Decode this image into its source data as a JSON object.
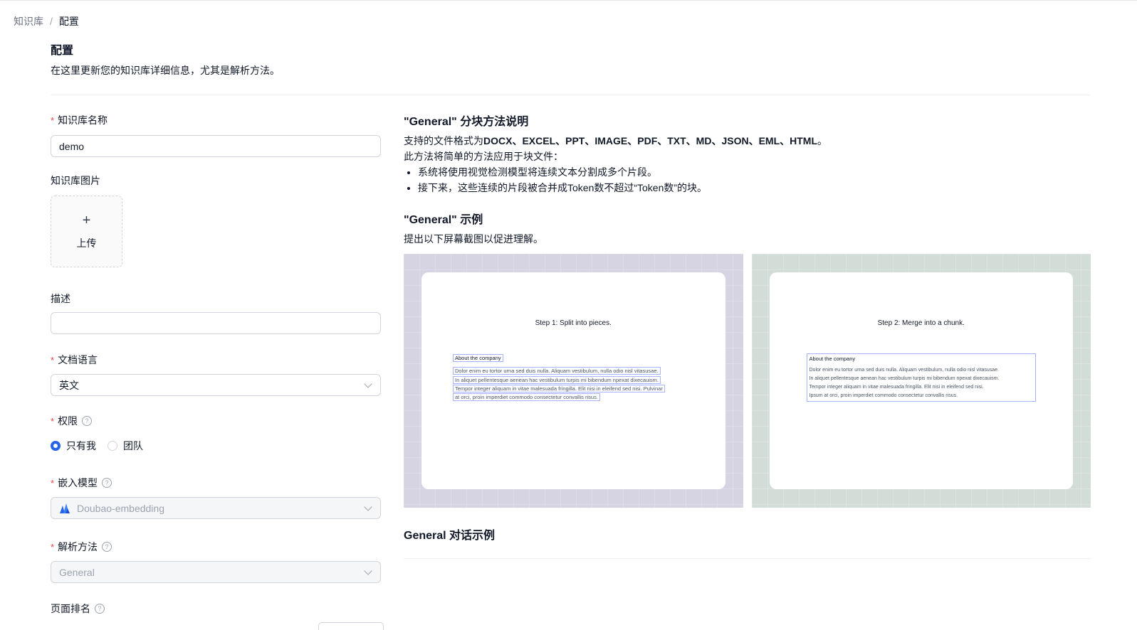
{
  "breadcrumb": {
    "parent": "知识库",
    "separator": "/",
    "current": "配置"
  },
  "header": {
    "title": "配置",
    "description": "在这里更新您的知识库详细信息，尤其是解析方法。"
  },
  "form": {
    "required_mark": "*",
    "name": {
      "label": "知识库名称",
      "value": "demo"
    },
    "image": {
      "label": "知识库图片",
      "upload_plus": "+",
      "upload_label": "上传"
    },
    "description": {
      "label": "描述",
      "value": ""
    },
    "language": {
      "label": "文档语言",
      "value": "英文"
    },
    "permission": {
      "label": "权限",
      "help": "?",
      "options": [
        {
          "label": "只有我",
          "selected": true
        },
        {
          "label": "团队",
          "selected": false
        }
      ]
    },
    "embedding_model": {
      "label": "嵌入模型",
      "help": "?",
      "value": "Doubao-embedding",
      "icon": "doubao-logo-icon"
    },
    "parse_method": {
      "label": "解析方法",
      "help": "?",
      "value": "General"
    },
    "page_rank": {
      "label": "页面排名",
      "help": "?"
    }
  },
  "explain": {
    "title": "\"General\" 分块方法说明",
    "formats_prefix": "支持的文件格式为",
    "formats": "DOCX、EXCEL、PPT、IMAGE、PDF、TXT、MD、JSON、EML、HTML",
    "formats_suffix": "。",
    "intro": "此方法将简单的方法应用于块文件：",
    "bullets": [
      "系统将使用视觉检测模型将连续文本分割成多个片段。",
      "接下来，这些连续的片段被合并成Token数不超过“Token数”的块。"
    ],
    "example_title": "\"General\" 示例",
    "example_desc": "提出以下屏幕截图以促进理解。"
  },
  "screenshots": {
    "step1": {
      "title": "Step 1: Split into pieces.",
      "fragments": [
        "About the company",
        "Dolor enim eu tortor urna sed duis nulla. Aliquam vestibulum, nulla odio nisl vitasusae.",
        "In aliquet pellentesque aenean hac vestibulum turpis mi bibendum npexat dixecauism.",
        "Tempor integer aliquam in vitae malesuada fringilla. Elit nisi in eleifend sed nisi. Pulvinar",
        "at orci, proin imperdiet commodo consectetur convallis risus."
      ]
    },
    "step2": {
      "title": "Step 2: Merge into a chunk.",
      "heading": "About the company",
      "lines": [
        "Dolor enim eu tortor urna sed duis nulla. Aliquam vestibulum, nulla odio nisl vitasusae.",
        "In aliquet pellentesque aenean hac vestibulum turpis mi bibendum npexat dixecauism.",
        "Tempor integer aliquam in vitae malesuada fringilla. Elit nisi in eleifend sed nisi.",
        "Ipsum at orci, proin imperdiet commodo consectetur convallis risus."
      ]
    }
  },
  "chat_example": {
    "title": "General 对话示例"
  },
  "colors": {
    "accent": "#2563eb",
    "required": "#ef4444",
    "step1_bg": "#d6d3e3",
    "step2_bg": "#d2ddd8"
  }
}
